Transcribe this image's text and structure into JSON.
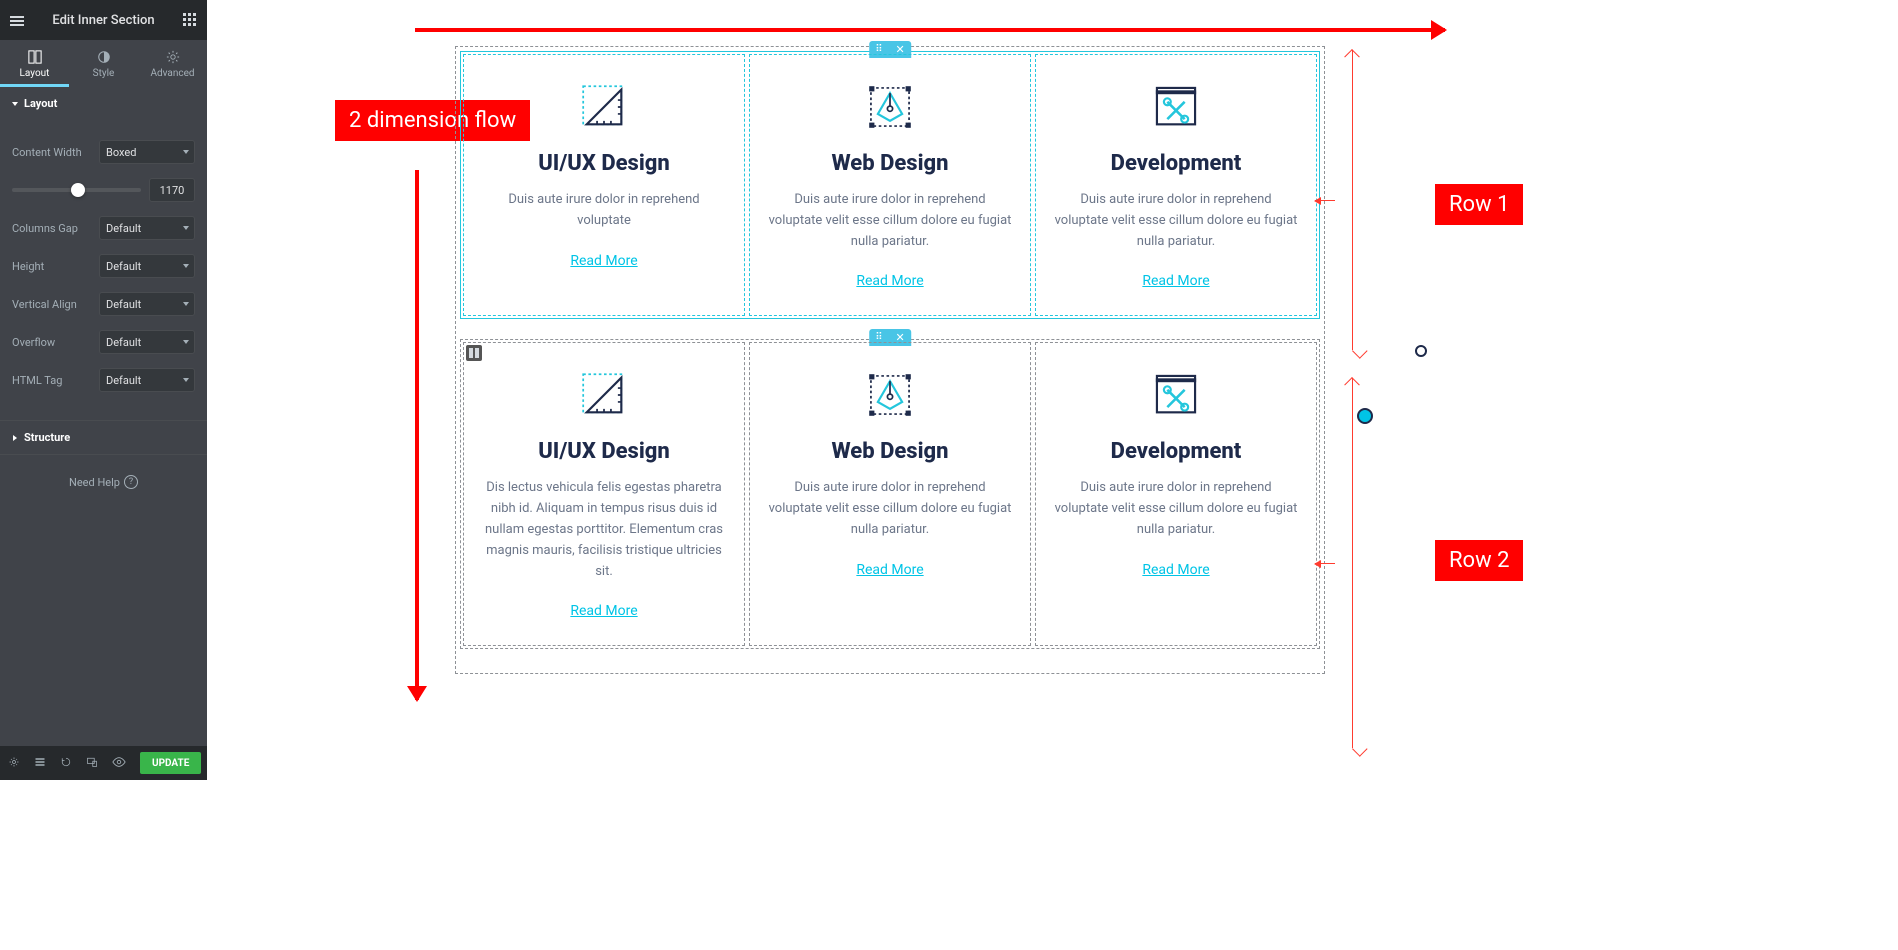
{
  "sidebar": {
    "title": "Edit Inner Section",
    "tabs": {
      "layout": "Layout",
      "style": "Style",
      "advanced": "Advanced"
    },
    "sections": {
      "layout_title": "Layout",
      "structure_title": "Structure"
    },
    "fields": {
      "content_width_label": "Content Width",
      "content_width_value": "Boxed",
      "width_number": "1170",
      "columns_gap_label": "Columns Gap",
      "columns_gap_value": "Default",
      "height_label": "Height",
      "height_value": "Default",
      "vertical_align_label": "Vertical Align",
      "vertical_align_value": "Default",
      "overflow_label": "Overflow",
      "overflow_value": "Default",
      "html_tag_label": "HTML Tag",
      "html_tag_value": "Default"
    },
    "need_help": "Need Help",
    "update_btn": "UPDATE"
  },
  "annotations": {
    "flow_label": "2 dimension flow",
    "row1": "Row 1",
    "row2": "Row 2"
  },
  "rows": [
    {
      "cards": [
        {
          "title": "UI/UX Design",
          "desc": "Duis aute irure dolor in reprehend voluptate",
          "link": "Read More"
        },
        {
          "title": "Web Design",
          "desc": "Duis aute irure dolor in reprehend voluptate velit esse cillum dolore eu fugiat nulla pariatur.",
          "link": "Read More"
        },
        {
          "title": "Development",
          "desc": "Duis aute irure dolor in reprehend voluptate velit esse cillum dolore eu fugiat nulla pariatur.",
          "link": "Read More"
        }
      ]
    },
    {
      "cards": [
        {
          "title": "UI/UX Design",
          "desc": "Dis lectus vehicula felis egestas pharetra nibh id. Aliquam in tempus risus duis id nullam egestas porttitor. Elementum cras magnis mauris, facilisis tristique ultricies sit.",
          "link": "Read More"
        },
        {
          "title": "Web Design",
          "desc": "Duis aute irure dolor in reprehend voluptate velit esse cillum dolore eu fugiat nulla pariatur.",
          "link": "Read More"
        },
        {
          "title": "Development",
          "desc": "Duis aute irure dolor in reprehend voluptate velit esse cillum dolore eu fugiat nulla pariatur.",
          "link": "Read More"
        }
      ]
    }
  ]
}
